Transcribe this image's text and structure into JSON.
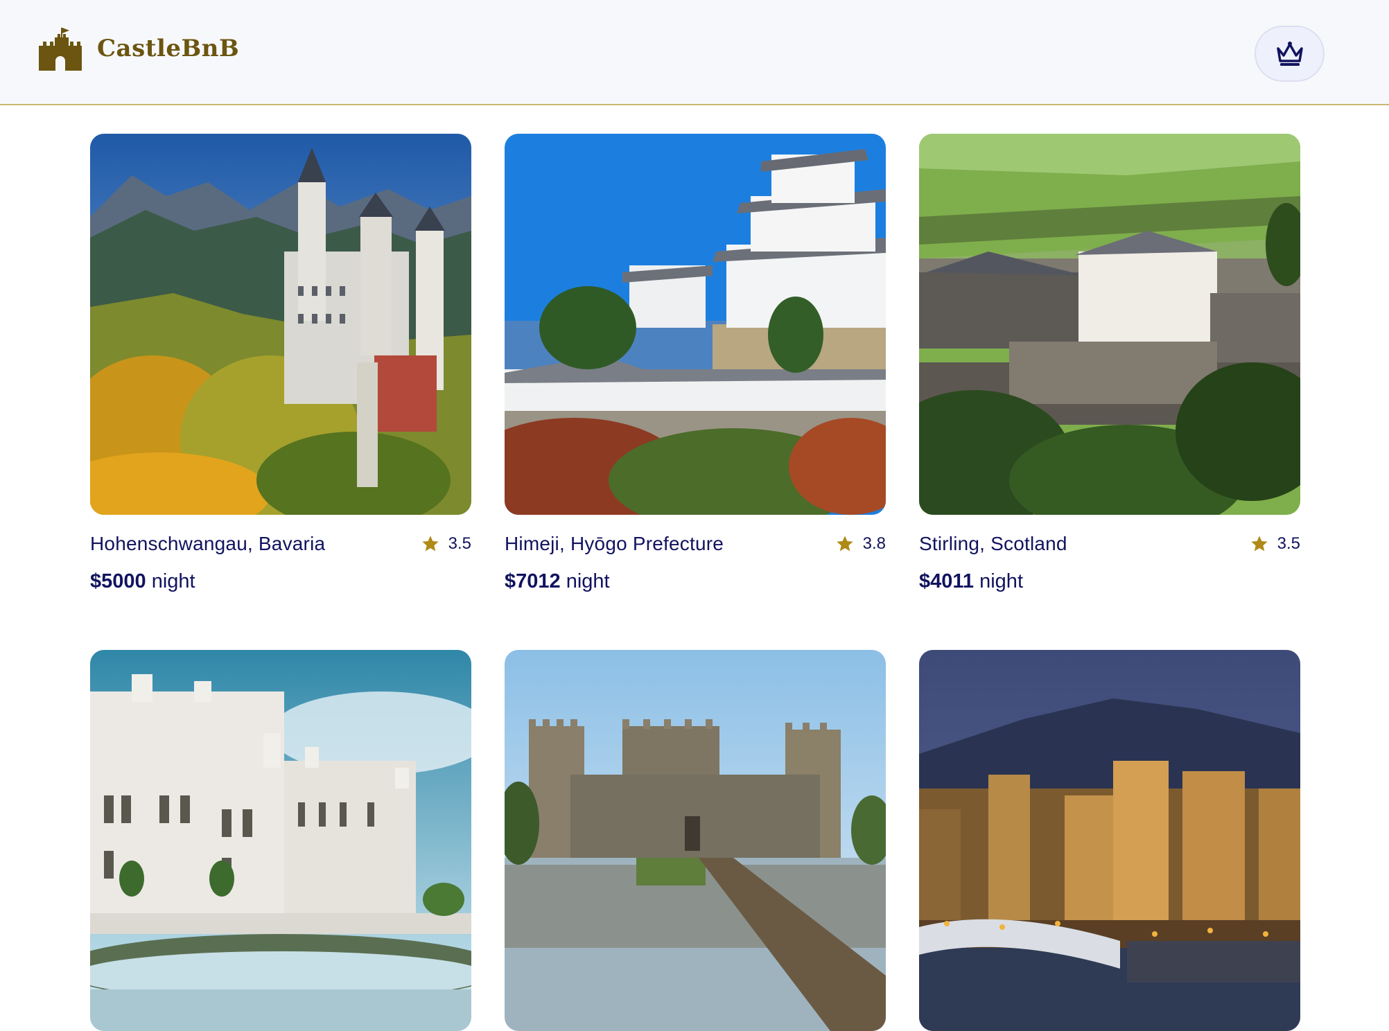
{
  "app": {
    "name": "CastleBnB"
  },
  "colors": {
    "brand": "#6b5510",
    "text": "#11135e",
    "star": "#b08a17",
    "header_bg": "#f7f8fb"
  },
  "header": {
    "profile_icon": "crown-icon",
    "logo_icon": "castle-icon"
  },
  "listings": [
    {
      "location": "Hohenschwangau, Bavaria",
      "rating": "3.5",
      "price": "$5000",
      "unit": "night",
      "image": "neuschwanstein-castle-photo"
    },
    {
      "location": "Himeji, Hyōgo Prefecture",
      "rating": "3.8",
      "price": "$7012",
      "unit": "night",
      "image": "himeji-castle-photo"
    },
    {
      "location": "Stirling, Scotland",
      "rating": "3.5",
      "price": "$4011",
      "unit": "night",
      "image": "stirling-castle-photo"
    },
    {
      "location": "",
      "rating": "",
      "price": "",
      "unit": "",
      "image": "miramare-castle-photo"
    },
    {
      "location": "",
      "rating": "",
      "price": "",
      "unit": "",
      "image": "bodiam-castle-photo"
    },
    {
      "location": "",
      "rating": "",
      "price": "",
      "unit": "",
      "image": "conwy-castle-photo"
    }
  ]
}
